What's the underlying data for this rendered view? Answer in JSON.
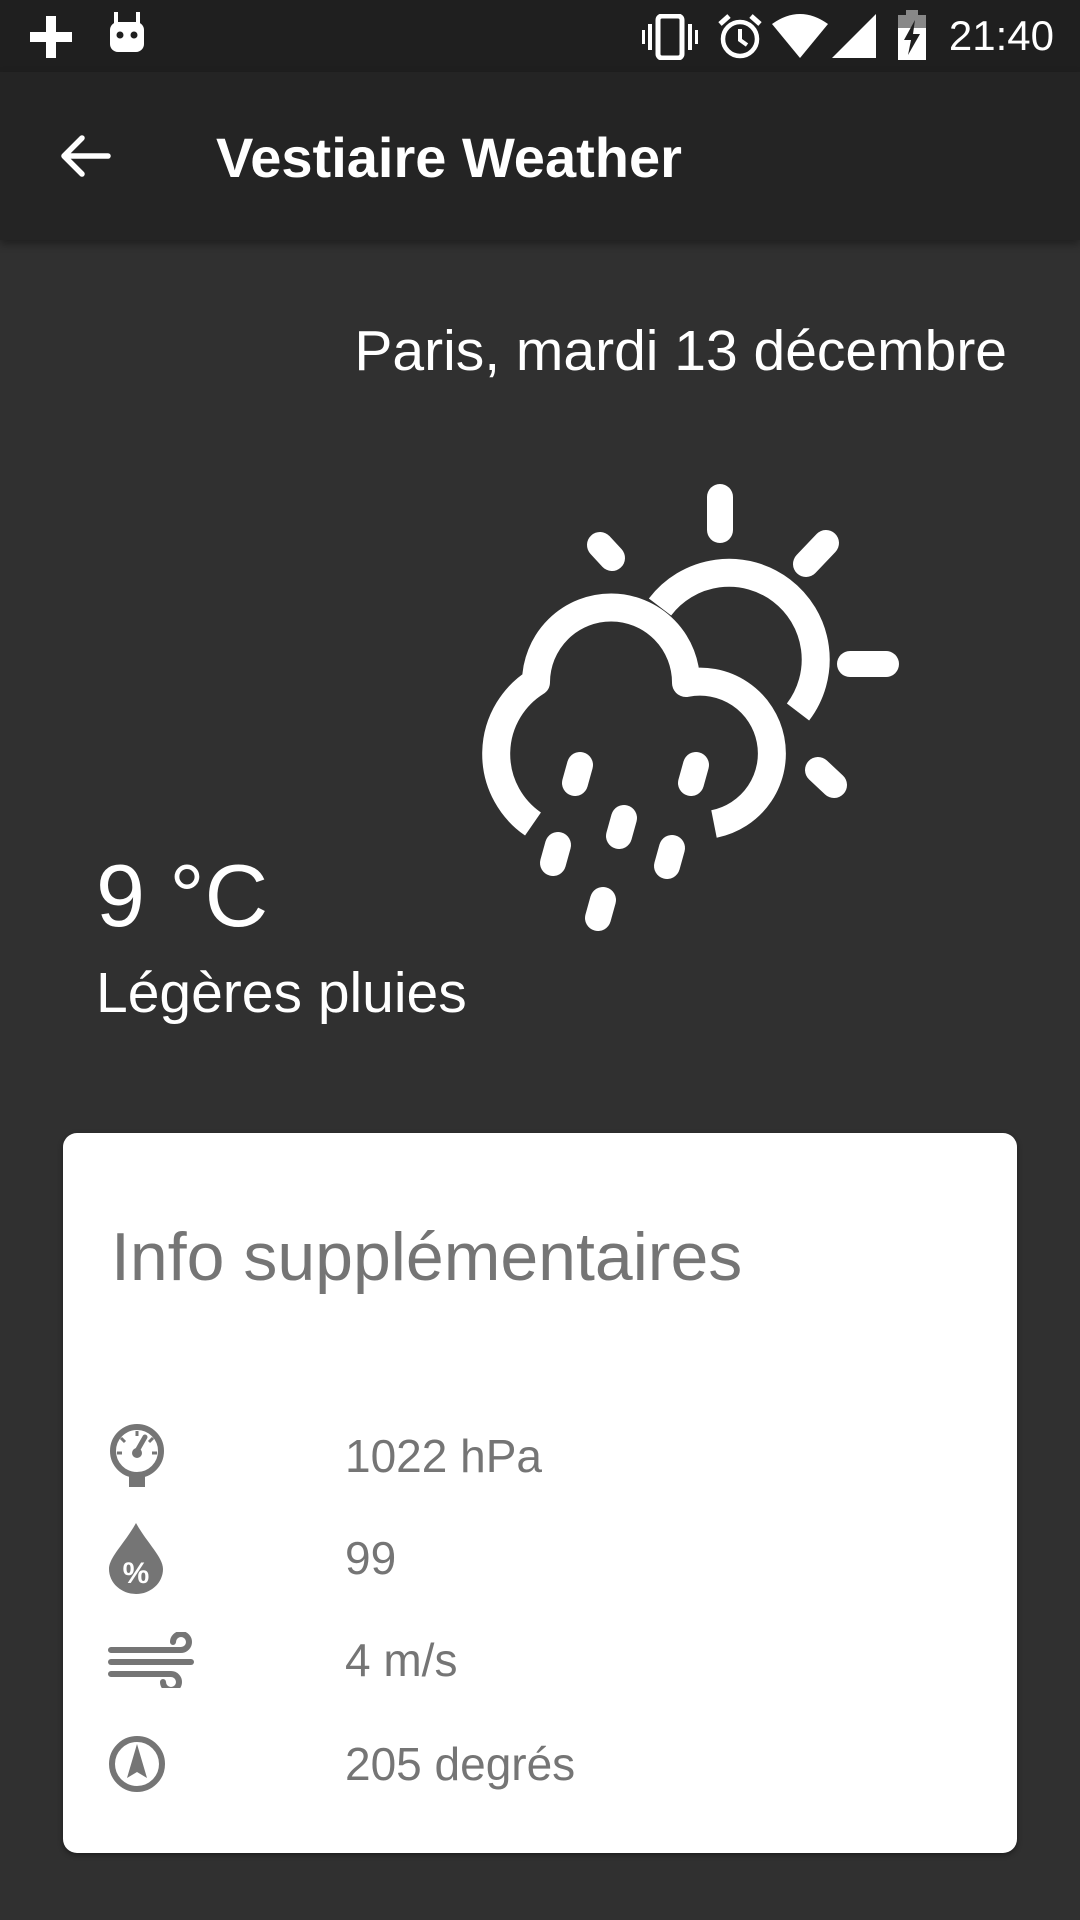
{
  "status_bar": {
    "time": "21:40",
    "icons": [
      "plus-icon",
      "android-icon",
      "vibrate-icon",
      "alarm-icon",
      "wifi-icon",
      "signal-icon",
      "battery-charging-icon"
    ]
  },
  "app_bar": {
    "title": "Vestiaire Weather",
    "back_icon": "arrow-back-icon"
  },
  "weather": {
    "location_date": "Paris, mardi 13 décembre",
    "temperature": "9 °C",
    "condition": "Légères pluies",
    "icon": "partly-cloudy-rain-icon"
  },
  "info_card": {
    "title": "Info supplémentaires",
    "rows": [
      {
        "icon": "pressure-gauge-icon",
        "value": "1022 hPa"
      },
      {
        "icon": "humidity-drop-icon",
        "value": "99"
      },
      {
        "icon": "wind-icon",
        "value": "4 m/s"
      },
      {
        "icon": "compass-icon",
        "value": "205 degrés"
      }
    ]
  },
  "colors": {
    "background": "#303030",
    "app_bar": "#242424",
    "status_bar": "#1f1f1f",
    "card": "#ffffff",
    "card_text": "#757575",
    "text": "#ffffff"
  }
}
